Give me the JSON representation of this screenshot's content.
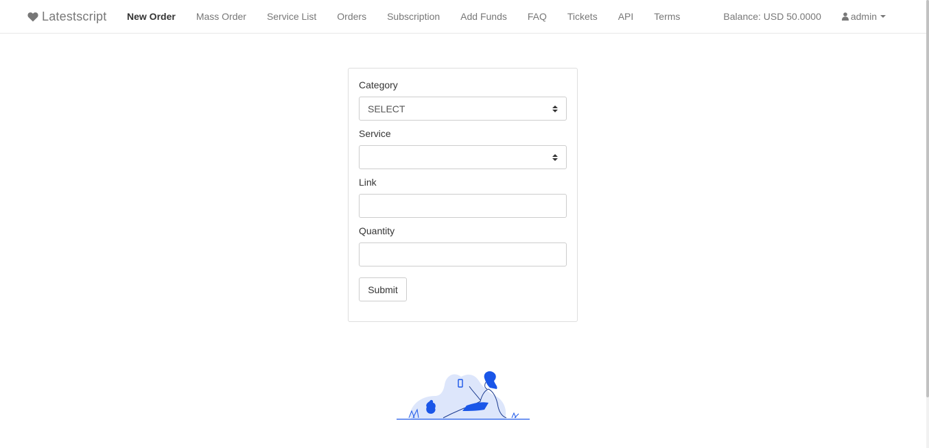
{
  "brand": {
    "name": "Latestscript",
    "icon": "heart-icon"
  },
  "nav": {
    "items": [
      {
        "label": "New Order",
        "active": true
      },
      {
        "label": "Mass Order"
      },
      {
        "label": "Service List"
      },
      {
        "label": "Orders"
      },
      {
        "label": "Subscription"
      },
      {
        "label": "Add Funds"
      },
      {
        "label": "FAQ"
      },
      {
        "label": "Tickets"
      },
      {
        "label": "API"
      },
      {
        "label": "Terms"
      }
    ],
    "balance": "Balance: USD 50.0000",
    "user": {
      "name": "admin",
      "icon": "user-icon"
    }
  },
  "form": {
    "category": {
      "label": "Category",
      "value": "SELECT"
    },
    "service": {
      "label": "Service",
      "value": ""
    },
    "link": {
      "label": "Link",
      "value": ""
    },
    "quantity": {
      "label": "Quantity",
      "value": ""
    },
    "submit_label": "Submit"
  },
  "colors": {
    "accent": "#1a56e8",
    "accent_light": "#dde6fb",
    "nav_text": "#777777",
    "border": "#dddddd"
  }
}
